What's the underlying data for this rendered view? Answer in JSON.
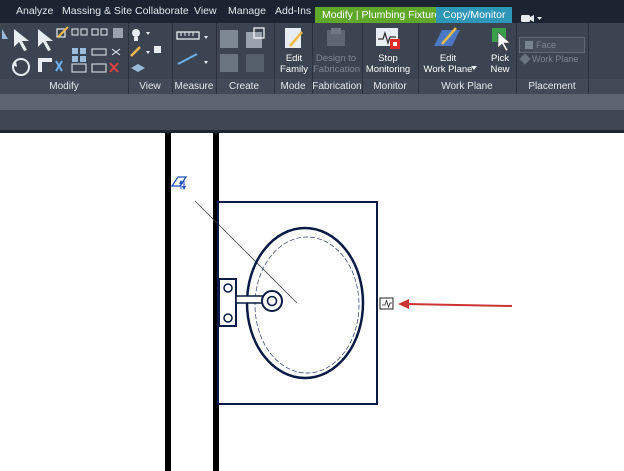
{
  "menu": {
    "tabs": [
      "Analyze",
      "Massing & Site",
      "Collaborate",
      "View",
      "Manage",
      "Add-Ins"
    ],
    "context_tab": "Modify | Plumbing Fixtures",
    "copy_monitor_tab": "Copy/Monitor",
    "colors": {
      "bar": "#1b2430",
      "context": "#60a82a",
      "copy_monitor": "#2e97b8"
    }
  },
  "ribbon": {
    "buttons": {
      "edit_family": "Edit\nFamily",
      "design_to_fabrication": "Design to\nFabrication",
      "stop_monitoring": "Stop\nMonitoring",
      "edit_work_plane": "Edit\nWork Plane",
      "pick_new": "Pick\nNew",
      "face": "Face",
      "work_plane": "Work Plane"
    },
    "panels": [
      "Modify",
      "View",
      "Measure",
      "Create",
      "Mode",
      "Fabrication",
      "Monitor",
      "Work Plane",
      "Placement"
    ]
  },
  "drawing": {
    "annotation_color": "#cc3333",
    "geometry_color": "#0a1a44"
  }
}
